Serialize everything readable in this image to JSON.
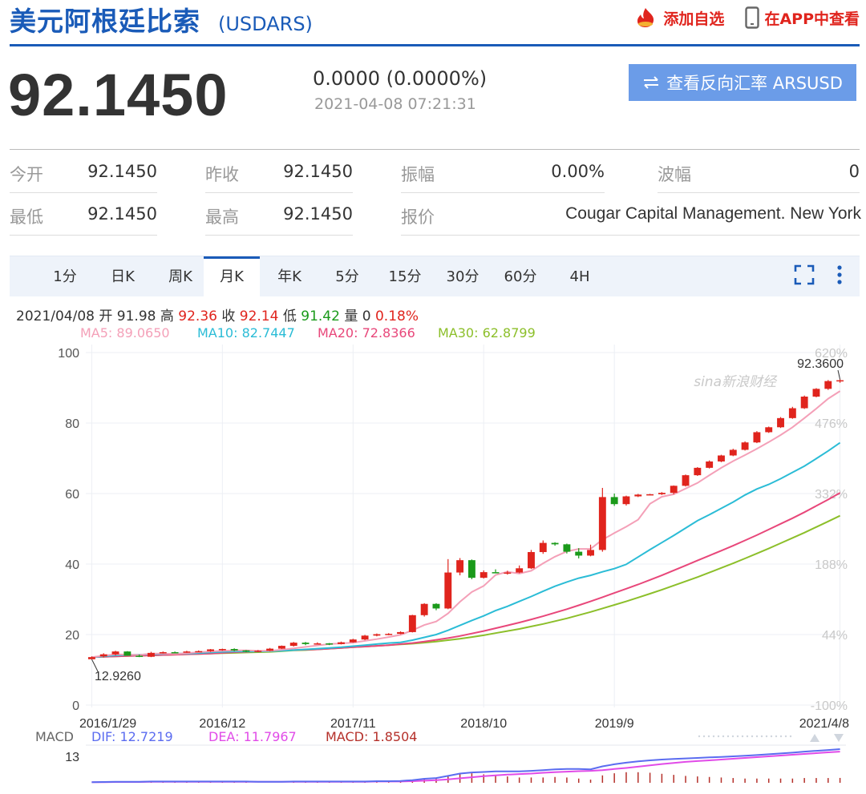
{
  "header": {
    "title": "美元阿根廷比索",
    "code": "(USDARS)",
    "add_watch": "添加自选",
    "app_view": "在APP中查看"
  },
  "quote": {
    "price": "92.1450",
    "change": "0.0000 (0.0000%)",
    "time": "2021-04-08 07:21:31",
    "reverse_button": "查看反向汇率 ARSUSD"
  },
  "stats": {
    "open_label": "今开",
    "open": "92.1450",
    "prev_close_label": "昨收",
    "prev_close": "92.1450",
    "amplitude_label": "振幅",
    "amplitude": "0.00%",
    "wave_label": "波幅",
    "wave": "0",
    "low_label": "最低",
    "low": "92.1450",
    "high_label": "最高",
    "high": "92.1450",
    "quoter_label": "报价",
    "quoter": "Cougar Capital Management. New York"
  },
  "tabs": [
    "1分",
    "日K",
    "周K",
    "月K",
    "年K",
    "5分",
    "15分",
    "30分",
    "60分",
    "4H"
  ],
  "active_tab": "月K",
  "ohlc_bar": {
    "date": "2021/04/08",
    "open_label": "开",
    "open": "91.98",
    "high_label": "高",
    "high": "92.36",
    "close_label": "收",
    "close": "92.14",
    "low_label": "低",
    "low": "91.42",
    "volume_label": "量",
    "volume": "0",
    "pct": "0.18%"
  },
  "ma_legend": {
    "ma5": "MA5: 89.0650",
    "ma10": "MA10: 82.7447",
    "ma20": "MA20: 72.8366",
    "ma30": "MA30: 62.8799"
  },
  "watermark": "sina新浪财经",
  "macd_legend": {
    "label": "MACD",
    "dif": "DIF: 12.7219",
    "dea": "DEA: 11.7967",
    "macd": "MACD: 1.8504",
    "axis_tick": "13"
  },
  "colors": {
    "up": "#e0241d",
    "down": "#1a9a1a",
    "ma5": "#f4a0b8",
    "ma10": "#2bbcd6",
    "ma20": "#e8477a",
    "ma30": "#8cbf2a",
    "dif": "#5b6cf0",
    "dea": "#e14be8",
    "macd": "#b5302a",
    "accent": "#1a5bb8"
  },
  "chart_data": {
    "type": "candlestick",
    "period": "monthly",
    "y_ticks": [
      "100",
      "80",
      "60",
      "40",
      "20",
      "0"
    ],
    "ylim": [
      0,
      100
    ],
    "pct_ticks": [
      "620%",
      "476%",
      "332%",
      "188%",
      "44%",
      "-100%"
    ],
    "x_ticks": [
      "2016/1/29",
      "2016/12",
      "2017/11",
      "2018/10",
      "2019/9",
      "2021/4/8"
    ],
    "x_tick_index": [
      0,
      11,
      22,
      33,
      44,
      63
    ],
    "max_label": "92.3600",
    "min_label": "12.9260",
    "candles": [
      [
        13.0,
        13.8,
        13.2,
        13.6
      ],
      [
        13.8,
        14.7,
        13.5,
        14.4
      ],
      [
        14.4,
        15.4,
        14.1,
        15.2
      ],
      [
        15.2,
        15.3,
        14.0,
        14.0
      ],
      [
        14.0,
        14.3,
        13.6,
        13.7
      ],
      [
        13.7,
        15.1,
        13.6,
        14.8
      ],
      [
        14.8,
        15.2,
        14.6,
        15.0
      ],
      [
        15.0,
        15.2,
        14.7,
        14.9
      ],
      [
        14.9,
        15.4,
        14.8,
        15.2
      ],
      [
        15.2,
        15.5,
        15.0,
        15.3
      ],
      [
        15.3,
        15.9,
        15.1,
        15.8
      ],
      [
        15.8,
        16.0,
        15.4,
        15.9
      ],
      [
        15.9,
        16.1,
        15.3,
        15.5
      ],
      [
        15.5,
        15.6,
        15.0,
        15.2
      ],
      [
        15.2,
        15.6,
        15.0,
        15.4
      ],
      [
        15.4,
        16.2,
        15.3,
        16.0
      ],
      [
        16.0,
        16.9,
        15.9,
        16.8
      ],
      [
        16.8,
        17.9,
        16.6,
        17.7
      ],
      [
        17.7,
        17.9,
        17.0,
        17.3
      ],
      [
        17.3,
        17.8,
        17.2,
        17.5
      ],
      [
        17.5,
        17.6,
        17.0,
        17.3
      ],
      [
        17.3,
        18.0,
        17.2,
        17.8
      ],
      [
        17.8,
        18.8,
        17.7,
        18.6
      ],
      [
        18.6,
        19.9,
        18.4,
        19.7
      ],
      [
        19.7,
        20.3,
        19.5,
        20.1
      ],
      [
        20.1,
        20.4,
        19.8,
        20.2
      ],
      [
        20.2,
        20.9,
        20.1,
        20.7
      ],
      [
        20.7,
        25.6,
        20.6,
        25.5
      ],
      [
        25.5,
        28.9,
        25.1,
        28.7
      ],
      [
        28.7,
        28.9,
        26.9,
        27.4
      ],
      [
        27.4,
        41.4,
        27.2,
        37.6
      ],
      [
        37.6,
        41.7,
        36.8,
        41.1
      ],
      [
        41.1,
        41.3,
        35.7,
        36.1
      ],
      [
        36.1,
        38.2,
        35.9,
        37.7
      ],
      [
        37.7,
        38.5,
        37.4,
        37.5
      ],
      [
        37.5,
        38.1,
        37.0,
        37.6
      ],
      [
        37.6,
        39.6,
        37.4,
        38.8
      ],
      [
        38.8,
        44.0,
        38.6,
        43.4
      ],
      [
        43.4,
        46.7,
        42.9,
        46.0
      ],
      [
        46.0,
        46.2,
        45.2,
        45.6
      ],
      [
        45.6,
        45.8,
        43.0,
        43.5
      ],
      [
        43.5,
        44.5,
        41.6,
        42.4
      ],
      [
        42.4,
        45.5,
        42.2,
        44.0
      ],
      [
        44.0,
        61.6,
        43.5,
        59.0
      ],
      [
        59.0,
        60.0,
        56.5,
        57.0
      ],
      [
        57.0,
        59.4,
        56.6,
        59.2
      ],
      [
        59.2,
        59.9,
        59.0,
        59.7
      ],
      [
        59.7,
        59.9,
        59.5,
        59.8
      ],
      [
        59.8,
        60.4,
        59.6,
        60.2
      ],
      [
        60.2,
        62.3,
        59.8,
        62.2
      ],
      [
        62.2,
        65.4,
        62.0,
        65.2
      ],
      [
        65.2,
        67.5,
        65.0,
        67.3
      ],
      [
        67.3,
        69.4,
        67.1,
        69.1
      ],
      [
        69.1,
        71.0,
        68.9,
        70.8
      ],
      [
        70.8,
        72.7,
        70.6,
        72.4
      ],
      [
        72.4,
        74.8,
        72.2,
        74.5
      ],
      [
        74.5,
        77.7,
        74.3,
        77.4
      ],
      [
        77.4,
        79.0,
        77.2,
        78.8
      ],
      [
        78.8,
        81.7,
        78.6,
        81.4
      ],
      [
        81.4,
        84.6,
        81.2,
        84.2
      ],
      [
        84.2,
        87.8,
        84.0,
        87.5
      ],
      [
        87.5,
        89.9,
        87.3,
        89.7
      ],
      [
        89.7,
        92.2,
        89.4,
        91.9
      ],
      [
        91.98,
        92.36,
        91.42,
        92.14
      ]
    ],
    "ma5": [
      13.6,
      14.0,
      14.4,
      14.3,
      14.2,
      14.6,
      14.6,
      14.5,
      14.7,
      15.0,
      15.2,
      15.4,
      15.5,
      15.5,
      15.4,
      15.4,
      15.7,
      16.1,
      16.5,
      16.9,
      17.3,
      17.5,
      17.7,
      18.2,
      18.7,
      19.3,
      19.9,
      21.2,
      22.7,
      23.7,
      26.0,
      29.3,
      32.1,
      33.8,
      36.9,
      37.8,
      37.3,
      38.1,
      40.2,
      42.1,
      43.6,
      44.3,
      44.3,
      46.9,
      48.8,
      50.6,
      52.6,
      57.1,
      59.1,
      59.8,
      61.4,
      63.0,
      65.2,
      67.3,
      69.2,
      70.9,
      72.7,
      74.6,
      76.6,
      78.8,
      81.4,
      84.1,
      86.9,
      89.07
    ],
    "ma10": [
      13.6,
      13.8,
      14.1,
      14.2,
      14.3,
      14.4,
      14.5,
      14.6,
      14.6,
      14.7,
      14.9,
      15.1,
      15.2,
      15.2,
      15.2,
      15.3,
      15.4,
      15.6,
      15.8,
      16.0,
      16.2,
      16.4,
      16.7,
      17.0,
      17.3,
      17.6,
      17.8,
      18.4,
      19.2,
      20.0,
      21.2,
      22.6,
      24.0,
      25.3,
      26.8,
      28.0,
      29.4,
      30.8,
      32.3,
      33.7,
      34.9,
      36.0,
      36.8,
      37.8,
      38.7,
      39.9,
      42.0,
      44.1,
      46.1,
      48.1,
      50.2,
      52.3,
      54.0,
      55.8,
      57.6,
      59.6,
      61.3,
      62.6,
      64.2,
      66.0,
      67.8,
      69.9,
      72.1,
      74.4
    ],
    "ma20": [
      13.6,
      13.7,
      13.8,
      13.9,
      14.0,
      14.1,
      14.2,
      14.3,
      14.4,
      14.5,
      14.6,
      14.8,
      15.0,
      15.1,
      15.3,
      15.4,
      15.5,
      15.6,
      15.7,
      15.8,
      16.0,
      16.2,
      16.4,
      16.6,
      16.8,
      17.0,
      17.3,
      17.6,
      18.0,
      18.5,
      19.0,
      19.6,
      20.3,
      21.0,
      21.8,
      22.6,
      23.4,
      24.3,
      25.2,
      26.2,
      27.2,
      28.3,
      29.4,
      30.6,
      31.8,
      33.0,
      34.2,
      35.5,
      36.8,
      38.2,
      39.6,
      41.0,
      42.4,
      43.8,
      45.2,
      46.7,
      48.2,
      49.8,
      51.4,
      53.0,
      54.7,
      56.5,
      58.3,
      60.2
    ],
    "ma30": [
      13.6,
      13.7,
      13.8,
      13.9,
      14.0,
      14.1,
      14.2,
      14.3,
      14.4,
      14.5,
      14.6,
      14.7,
      14.8,
      14.9,
      15.0,
      15.1,
      15.3,
      15.5,
      15.6,
      15.8,
      16.0,
      16.2,
      16.4,
      16.6,
      16.8,
      17.0,
      17.2,
      17.4,
      17.7,
      18.0,
      18.4,
      18.8,
      19.3,
      19.8,
      20.4,
      21.0,
      21.6,
      22.3,
      23.0,
      23.8,
      24.6,
      25.5,
      26.4,
      27.4,
      28.4,
      29.4,
      30.5,
      31.6,
      32.7,
      33.9,
      35.1,
      36.3,
      37.6,
      38.9,
      40.2,
      41.6,
      43.0,
      44.4,
      45.9,
      47.4,
      48.9,
      50.5,
      52.1,
      53.7
    ],
    "macd_dif": [
      0.2,
      0.3,
      0.4,
      0.4,
      0.4,
      0.5,
      0.5,
      0.5,
      0.5,
      0.5,
      0.5,
      0.5,
      0.5,
      0.5,
      0.4,
      0.4,
      0.4,
      0.5,
      0.5,
      0.5,
      0.5,
      0.5,
      0.5,
      0.5,
      0.6,
      0.6,
      0.7,
      1.0,
      1.5,
      1.8,
      2.6,
      3.5,
      3.9,
      4.1,
      4.3,
      4.3,
      4.3,
      4.5,
      4.8,
      5.1,
      5.2,
      5.2,
      5.1,
      6.2,
      7.0,
      7.6,
      8.1,
      8.5,
      8.8,
      9.0,
      9.2,
      9.4,
      9.6,
      9.8,
      10.0,
      10.2,
      10.5,
      10.8,
      11.1,
      11.4,
      11.8,
      12.1,
      12.4,
      12.72
    ],
    "macd_dea": [
      0.2,
      0.2,
      0.3,
      0.3,
      0.3,
      0.4,
      0.4,
      0.4,
      0.4,
      0.4,
      0.4,
      0.4,
      0.4,
      0.4,
      0.4,
      0.4,
      0.4,
      0.4,
      0.4,
      0.4,
      0.4,
      0.4,
      0.4,
      0.4,
      0.5,
      0.5,
      0.5,
      0.6,
      0.8,
      1.0,
      1.3,
      1.7,
      2.1,
      2.5,
      2.8,
      3.1,
      3.3,
      3.5,
      3.8,
      4.0,
      4.2,
      4.4,
      4.5,
      4.8,
      5.2,
      5.6,
      6.1,
      6.6,
      7.1,
      7.5,
      7.9,
      8.2,
      8.5,
      8.8,
      9.1,
      9.4,
      9.7,
      10.0,
      10.3,
      10.6,
      10.9,
      11.2,
      11.5,
      11.8
    ]
  }
}
